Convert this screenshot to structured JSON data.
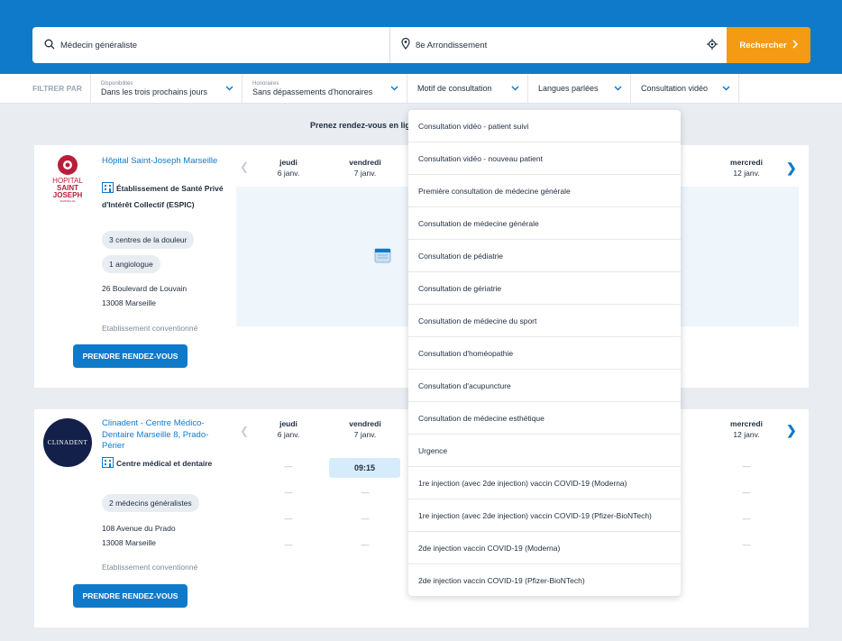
{
  "search": {
    "what_value": "Médecin généraliste",
    "where_value": "8e Arrondissement",
    "submit_label": "Rechercher"
  },
  "filters": {
    "label": "FILTRER PAR",
    "availability": {
      "small": "Disponibilités",
      "value": "Dans les trois prochains jours"
    },
    "fees": {
      "small": "Honoraires",
      "value": "Sans dépassements d'honoraires"
    },
    "reason": "Motif de consultation",
    "languages": "Langues parlées",
    "video": "Consultation vidéo"
  },
  "intro_text": "Prenez rendez-vous en ligne",
  "calendar_days": [
    {
      "name": "jeudi",
      "date": "6 janv."
    },
    {
      "name": "vendredi",
      "date": "7 janv."
    },
    {
      "name": "mercredi",
      "date": "12 janv."
    }
  ],
  "results": [
    {
      "name": "Hôpital Saint-Joseph Marseille",
      "type": "Établissement de Santé Privé d'Intérêt Collectif (ESPIC)",
      "pills": [
        "3 centres de la douleur",
        "1 angiologue"
      ],
      "address_line1": "26 Boulevard de Louvain",
      "address_line2": "13008 Marseille",
      "status": "Etablissement conventionné",
      "button": "PRENDRE RENDEZ-VOUS",
      "logo_text": [
        "HOPITAL",
        "SAINT",
        "JOSEPH",
        "MARSEILLE"
      ]
    },
    {
      "name": "Clinadent - Centre Médico-Dentaire Marseille 8, Prado-Périer",
      "type": "Centre médical et dentaire",
      "pills": [
        "2 médecins généralistes"
      ],
      "address_line1": "108 Avenue du Prado",
      "address_line2": "13008 Marseille",
      "status": "Etablissement conventionné",
      "button": "PRENDRE RENDEZ-VOUS",
      "logo_text": "CLINADENT",
      "slot": "09:15"
    }
  ],
  "dropdown": {
    "items": [
      "Consultation vidéo - patient suivi",
      "Consultation vidéo - nouveau patient",
      "Première consultation de médecine générale",
      "Consultation de médecine générale",
      "Consultation de pédiatrie",
      "Consultation de gériatrie",
      "Consultation de médecine du sport",
      "Consultation d'homéopathie",
      "Consultation d'acupuncture",
      "Consultation de médecine esthétique",
      "Urgence",
      "1re injection (avec 2de injection) vaccin COVID-19 (Moderna)",
      "1re injection (avec 2de injection) vaccin COVID-19 (Pfizer-BioNTech)",
      "2de injection vaccin COVID-19 (Moderna)",
      "2de injection vaccin COVID-19 (Pfizer-BioNTech)"
    ]
  },
  "colors": {
    "brand": "#107aca",
    "accent": "#f59b13",
    "slot_bg": "#d6ecfb"
  },
  "icons": [
    "search-icon",
    "map-pin-icon",
    "locate-icon",
    "chevron-right-icon",
    "chevron-down-icon",
    "building-icon",
    "calendar-icon"
  ]
}
